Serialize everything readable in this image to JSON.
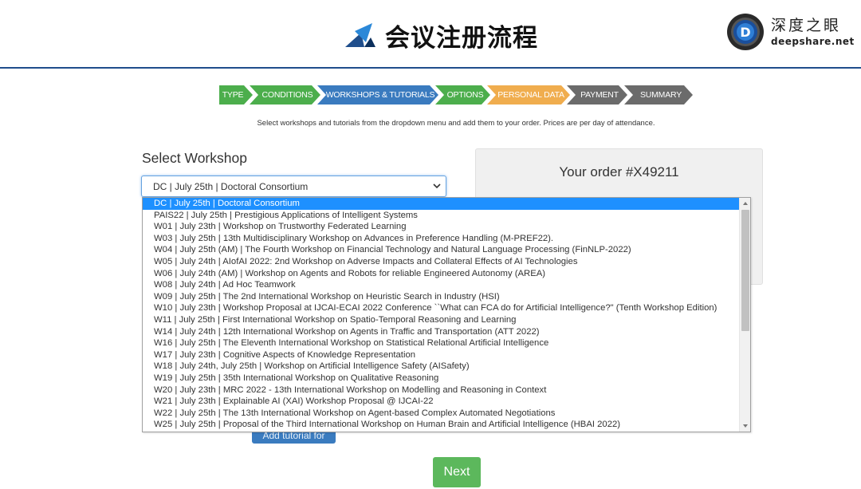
{
  "header": {
    "title": "会议注册流程",
    "brand_name": "深度之眼",
    "brand_url": "deepshare.net",
    "brand_logo_letter": "D"
  },
  "steps": [
    {
      "label": "TYPE",
      "color": "#4cae4c"
    },
    {
      "label": "CONDITIONS",
      "color": "#4cae4c"
    },
    {
      "label": "WORKSHOPS & TUTORIALS",
      "color": "#3a7bbf"
    },
    {
      "label": "OPTIONS",
      "color": "#4cae4c"
    },
    {
      "label": "PERSONAL DATA",
      "color": "#f0ad4e"
    },
    {
      "label": "PAYMENT",
      "color": "#6b6b6b"
    },
    {
      "label": "SUMMARY",
      "color": "#6b6b6b"
    }
  ],
  "instructions": "Select workshops and tutorials from the dropdown menu and add them to your order. Prices are per day of attendance.",
  "workshop_select": {
    "label": "Select Workshop",
    "selected_value": "DC | July 25th | Doctoral Consortium",
    "options": [
      "DC | July 25th | Doctoral Consortium",
      "PAIS22 | July 25th | Prestigious Applications of Intelligent Systems",
      "W01 | July 23th | Workshop on Trustworthy Federated Learning",
      "W03 | July 25th | 13th Multidisciplinary Workshop on Advances in Preference Handling (M-PREF22).",
      "W04 | July 25th (AM) | The Fourth Workshop on Financial Technology and Natural Language Processing (FinNLP-2022)",
      "W05 | July 24th | AIofAI 2022: 2nd Workshop on Adverse Impacts and Collateral Effects of AI Technologies",
      "W06 | July 24th (AM) | Workshop on Agents and Robots for reliable Engineered Autonomy (AREA)",
      "W08 | July 24th | Ad Hoc Teamwork",
      "W09 | July 25th | The 2nd International Workshop on Heuristic Search in Industry (HSI)",
      "W10 | July 23th | Workshop Proposal at IJCAI-ECAI 2022 Conference ``What can FCA do for Artificial Intelligence?\" (Tenth Workshop Edition)",
      "W11 | July 25th | First International Workshop on Spatio-Temporal Reasoning and Learning",
      "W14 | July 24th | 12th International Workshop on Agents in Traffic and Transportation (ATT 2022)",
      "W16 | July 25th | The Eleventh International Workshop on Statistical Relational Artificial Intelligence",
      "W17 | July 23th | Cognitive Aspects of Knowledge Representation",
      "W18 | July 24th, July 25th | Workshop on Artificial Intelligence Safety (AISafety)",
      "W19 | July 25th | 35th International Workshop on Qualitative Reasoning",
      "W20 | July 23th | MRC 2022 - 13th International Workshop on Modelling and Reasoning in Context",
      "W21 | July 23th | Explainable AI (XAI) Workshop Proposal @ IJCAI-22",
      "W22 | July 25th | The 13th International Workshop on Agent-based Complex Automated Negotiations",
      "W25 | July 25th | Proposal of the Third International Workshop on Human Brain and Artificial Intelligence (HBAI 2022)"
    ]
  },
  "add_button_label": "Add tutorial for",
  "order": {
    "title": "Your order #X49211"
  },
  "next_label": "Next",
  "colors": {
    "accent_blue": "#1f4e8c",
    "selected_option": "#1e90ff",
    "next_green": "#5cb85c"
  }
}
